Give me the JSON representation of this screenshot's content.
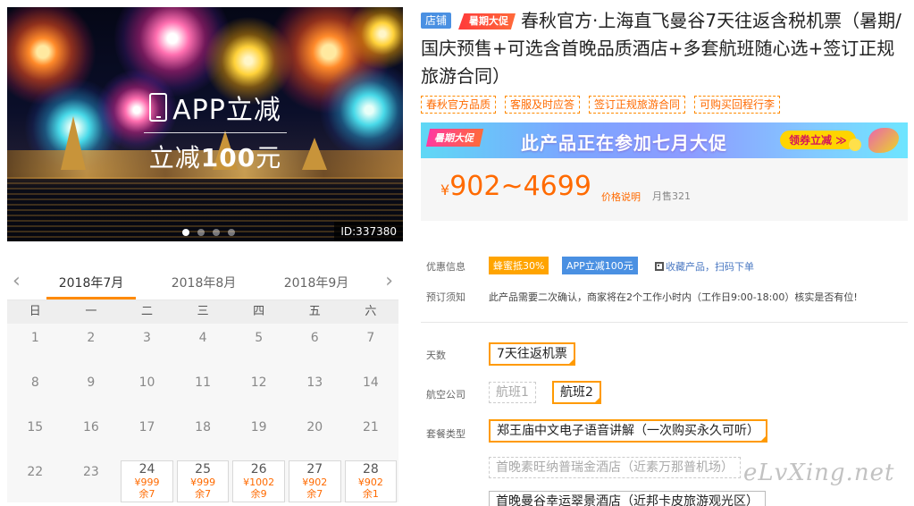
{
  "hero": {
    "promo_line1": "APP立减",
    "promo_line2_prefix": "立减",
    "promo_line2_amount": "100",
    "promo_line2_suffix": "元",
    "id_badge": "ID:337380"
  },
  "calendar": {
    "prev_icon": "chevron-left-icon",
    "next_icon": "chevron-right-icon",
    "months": [
      "2018年7月",
      "2018年8月",
      "2018年9月"
    ],
    "active_month_index": 0,
    "weekdays": [
      "日",
      "一",
      "二",
      "三",
      "四",
      "五",
      "六"
    ],
    "rows": [
      [
        {
          "d": "1"
        },
        {
          "d": "2"
        },
        {
          "d": "3"
        },
        {
          "d": "4"
        },
        {
          "d": "5"
        },
        {
          "d": "6"
        },
        {
          "d": "7"
        }
      ],
      [
        {
          "d": "8"
        },
        {
          "d": "9"
        },
        {
          "d": "10"
        },
        {
          "d": "11"
        },
        {
          "d": "12"
        },
        {
          "d": "13"
        },
        {
          "d": "14"
        }
      ],
      [
        {
          "d": "15"
        },
        {
          "d": "16"
        },
        {
          "d": "17"
        },
        {
          "d": "18"
        },
        {
          "d": "19"
        },
        {
          "d": "20"
        },
        {
          "d": "21"
        }
      ],
      [
        {
          "d": "22"
        },
        {
          "d": "23"
        },
        {
          "d": "24",
          "price": "¥999",
          "remain": "余7"
        },
        {
          "d": "25",
          "price": "¥999",
          "remain": "余7"
        },
        {
          "d": "26",
          "price": "¥1002",
          "remain": "余9"
        },
        {
          "d": "27",
          "price": "¥902",
          "remain": "余7"
        },
        {
          "d": "28",
          "price": "¥902",
          "remain": "余1"
        }
      ]
    ]
  },
  "product": {
    "store_tag": "店铺",
    "promo_tag": "暑期大促",
    "title": "春秋官方·上海直飞曼谷7天往返含税机票（暑期/国庆预售+可选含首晚品质酒店+多套航班随心选+签订正规旅游合同）",
    "features": [
      "春秋官方品质",
      "客服及时应答",
      "签订正规旅游合同",
      "可购买回程行李"
    ]
  },
  "banner": {
    "left_tag": "暑期大促",
    "text": "此产品正在参加七月大促",
    "button": "领券立减 ≫",
    "colors": {
      "button_bg": "#ffd400",
      "accent": "#ff3aa0"
    }
  },
  "price": {
    "currency": "¥",
    "range": "902~4699",
    "explain_link": "价格说明",
    "monthly_sales": "月售321"
  },
  "offers": {
    "label": "优惠信息",
    "badge1": "蜂蜜抵30%",
    "badge2": "APP立减100元",
    "link": "收藏产品，扫码下单"
  },
  "booking": {
    "label": "预订须知",
    "text": "此产品需要二次确认，商家将在2个工作小时内（工作日9:00-18:00）核实是否有位!"
  },
  "options": {
    "days_label": "天数",
    "days_options": [
      "7天往返机票"
    ],
    "airline_label": "航空公司",
    "airline_options": [
      "航班1",
      "航班2"
    ],
    "package_label": "套餐类型",
    "package_options": [
      "郑王庙中文电子语音讲解（一次购买永久可听）",
      "首晚素旺纳普瑞金酒店（近素万那普机场）",
      "首晚曼谷幸运翠景酒店（近邦卡皮旅游观光区）"
    ]
  },
  "watermark": "eLvXing.net",
  "colors": {
    "accent_orange": "#ff6a00",
    "selected_border": "#ff9a00",
    "blue": "#4a90e2"
  }
}
